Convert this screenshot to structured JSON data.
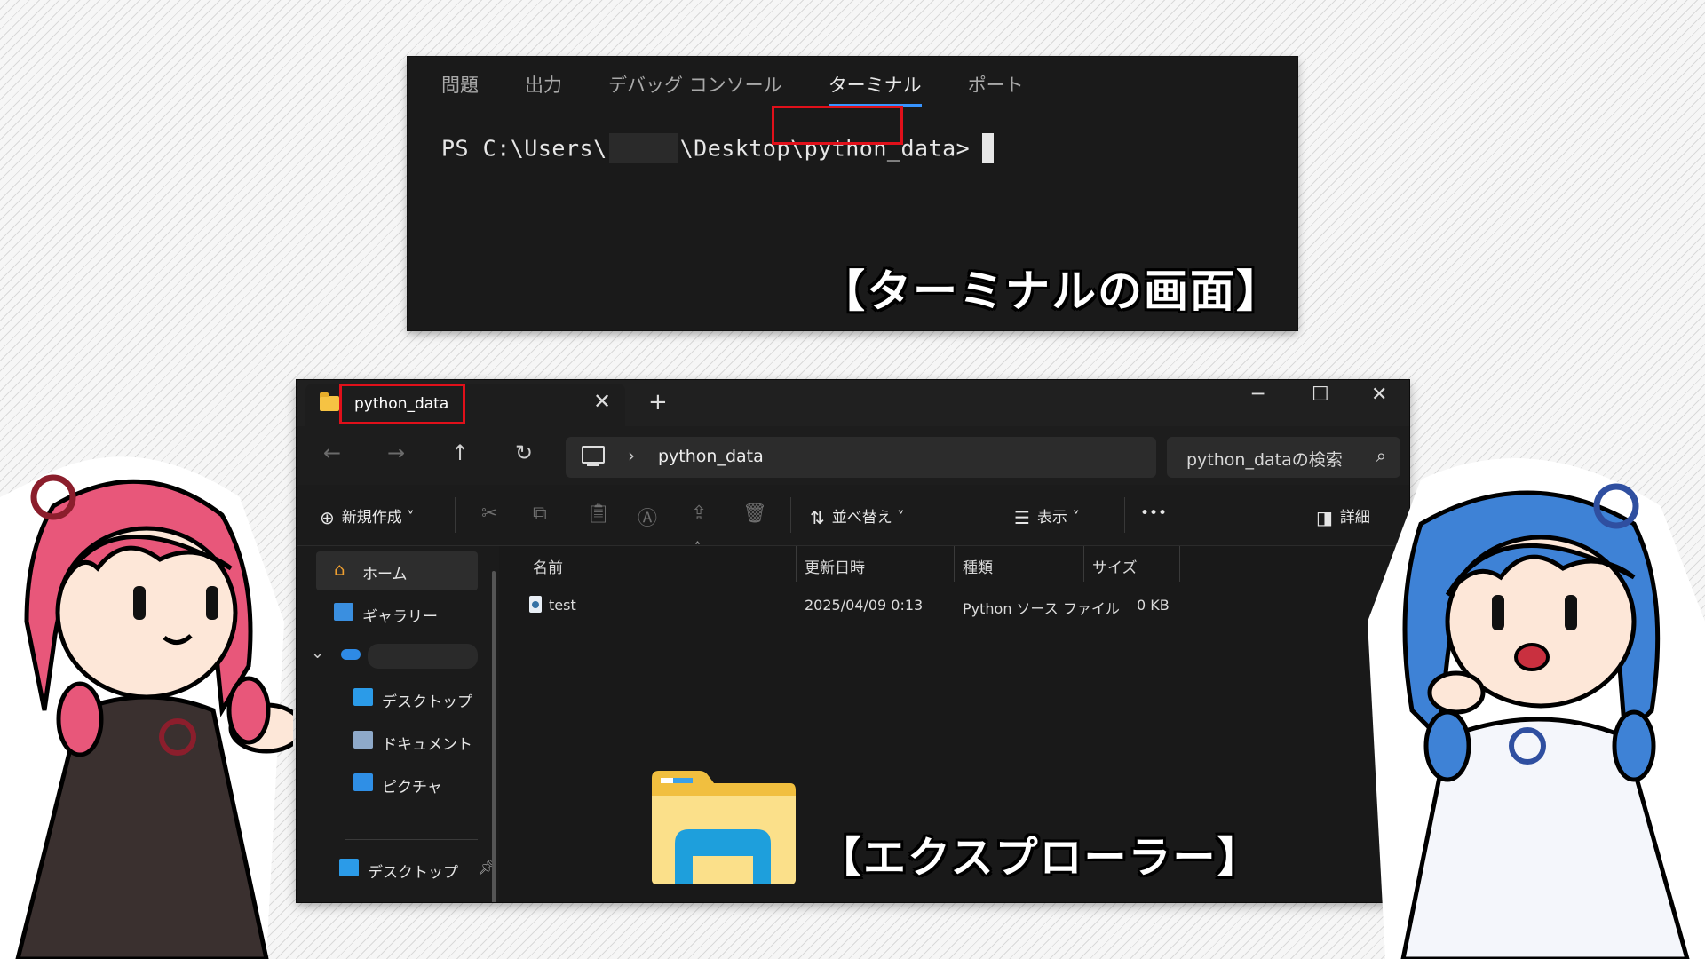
{
  "terminal": {
    "tabs": [
      "問題",
      "出力",
      "デバッグ コンソール",
      "ターミナル",
      "ポート"
    ],
    "active_tab_index": 3,
    "prompt_prefix": "PS C:\\Users\\",
    "prompt_mid": "\\Desktop",
    "prompt_highlight": "\\python_data>",
    "caption": "【ターミナルの画面】"
  },
  "explorer": {
    "tab_title": "python_data",
    "address_path": "python_data",
    "search_placeholder": "python_dataの検索",
    "toolbar": {
      "new": "新規作成",
      "sort": "並べ替え",
      "view": "表示",
      "more": "•••",
      "details": "詳細"
    },
    "sidebar": {
      "home": "ホーム",
      "gallery": "ギャラリー",
      "desktop": "デスクトップ",
      "documents": "ドキュメント",
      "pictures": "ピクチャ",
      "desktop_pinned": "デスクトップ"
    },
    "columns": [
      "名前",
      "更新日時",
      "種類",
      "サイズ"
    ],
    "files": [
      {
        "name": "test",
        "modified": "2025/04/09 0:13",
        "type": "Python ソース ファイル",
        "size": "0 KB"
      }
    ],
    "caption": "【エクスプローラー】"
  },
  "colors": {
    "highlight_red": "#e0101a",
    "terminal_bg": "#1a1a1a",
    "explorer_bg": "#191919",
    "active_tab_underline": "#3794ff",
    "folder_yellow": "#f9d878",
    "folder_blue": "#1e9fdc"
  }
}
